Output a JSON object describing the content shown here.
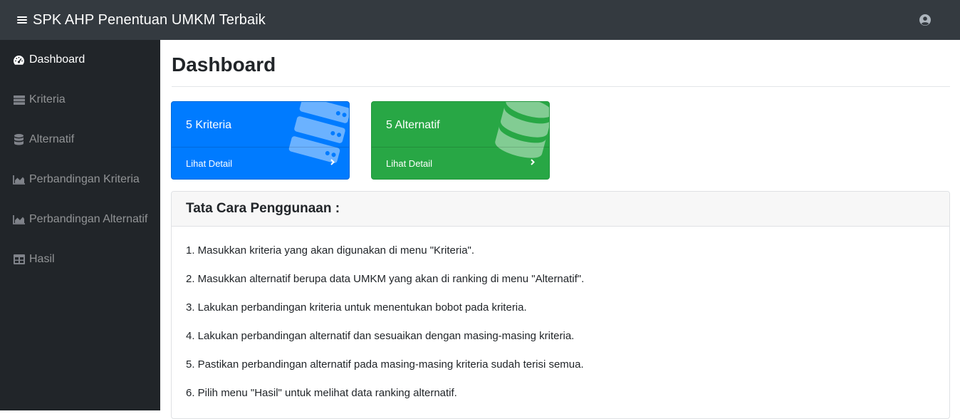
{
  "app": {
    "brand": "SPK AHP Penentuan UMKM Terbaik"
  },
  "sidebar": {
    "items": [
      {
        "label": "Dashboard",
        "icon": "tachometer-icon",
        "active": true
      },
      {
        "label": "Kriteria",
        "icon": "server-icon"
      },
      {
        "label": "Alternatif",
        "icon": "database-icon"
      },
      {
        "label": "Perbandingan Kriteria",
        "icon": "area-chart-icon"
      },
      {
        "label": "Perbandingan Alternatif",
        "icon": "area-chart-icon"
      },
      {
        "label": "Hasil",
        "icon": "table-icon"
      }
    ]
  },
  "main": {
    "title": "Dashboard",
    "cards": [
      {
        "text": "5 Kriteria",
        "link": "Lihat Detail",
        "color": "#007bff",
        "icon": "server-icon"
      },
      {
        "text": "5 Alternatif",
        "link": "Lihat Detail",
        "color": "#28a745",
        "icon": "database-icon"
      }
    ],
    "guide": {
      "title": "Tata Cara Penggunaan :",
      "steps": [
        "1. Masukkan kriteria yang akan digunakan di menu \"Kriteria\".",
        "2. Masukkan alternatif berupa data UMKM yang akan di ranking di menu \"Alternatif\".",
        "3. Lakukan perbandingan kriteria untuk menentukan bobot pada kriteria.",
        "4. Lakukan perbandingan alternatif dan sesuaikan dengan masing-masing kriteria.",
        "5. Pastikan perbandingan alternatif pada masing-masing kriteria sudah terisi semua.",
        "6. Pilih menu \"Hasil\" untuk melihat data ranking alternatif."
      ]
    }
  },
  "colors": {
    "topbar": "#343a40",
    "sidebar": "#212529",
    "primary": "#007bff",
    "success": "#28a745"
  }
}
